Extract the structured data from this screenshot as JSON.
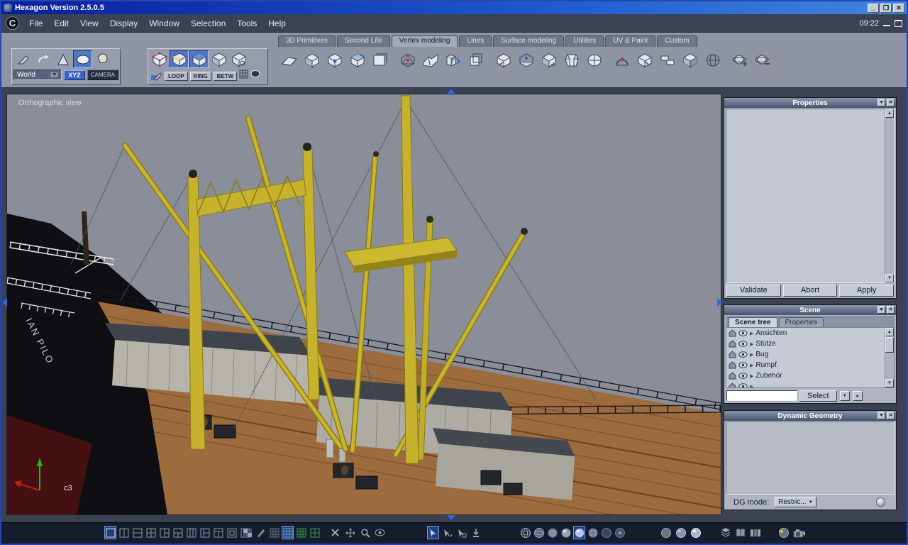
{
  "titlebar": {
    "title": "Hexagon Version 2.5.0.5"
  },
  "menubar": {
    "items": [
      "File",
      "Edit",
      "View",
      "Display",
      "Window",
      "Selection",
      "Tools",
      "Help"
    ],
    "clock": "09:22"
  },
  "tabs": {
    "items": [
      "3D Primitives",
      "Second Life",
      "Vertex modeling",
      "Lines",
      "Surface modeling",
      "Utilities",
      "UV & Paint",
      "Custom"
    ],
    "active": "Vertex modeling"
  },
  "toolbars": {
    "world": "World",
    "xyz": "XYZ",
    "camera": "CAMERA",
    "loop": "LOOP",
    "ring": "RING",
    "betw": "BETW"
  },
  "viewport": {
    "view_label": "Orthographic view",
    "marker": "c3",
    "hull_text": "IAN PILO"
  },
  "panels": {
    "properties": {
      "title": "Properties",
      "validate": "Validate",
      "abort": "Abort",
      "apply": "Apply"
    },
    "scene": {
      "title": "Scene",
      "tab1": "Scene tree",
      "tab2": "Properties",
      "items": [
        "Ansichten",
        "Stütze",
        "Bug",
        "Rumpf",
        "Zubehör"
      ],
      "select": "Select"
    },
    "dg": {
      "title": "Dynamic Geometry",
      "label": "DG mode:",
      "value": "Restric..."
    }
  },
  "icons": {
    "down": "▼",
    "up": "▲",
    "close": "✕",
    "expand": "▶",
    "min": "_",
    "max": "❐"
  },
  "colors": {
    "accent_blue": "#2a62d8",
    "mast_yellow": "#c7b22e",
    "deck_brown": "#9c6b3e"
  }
}
